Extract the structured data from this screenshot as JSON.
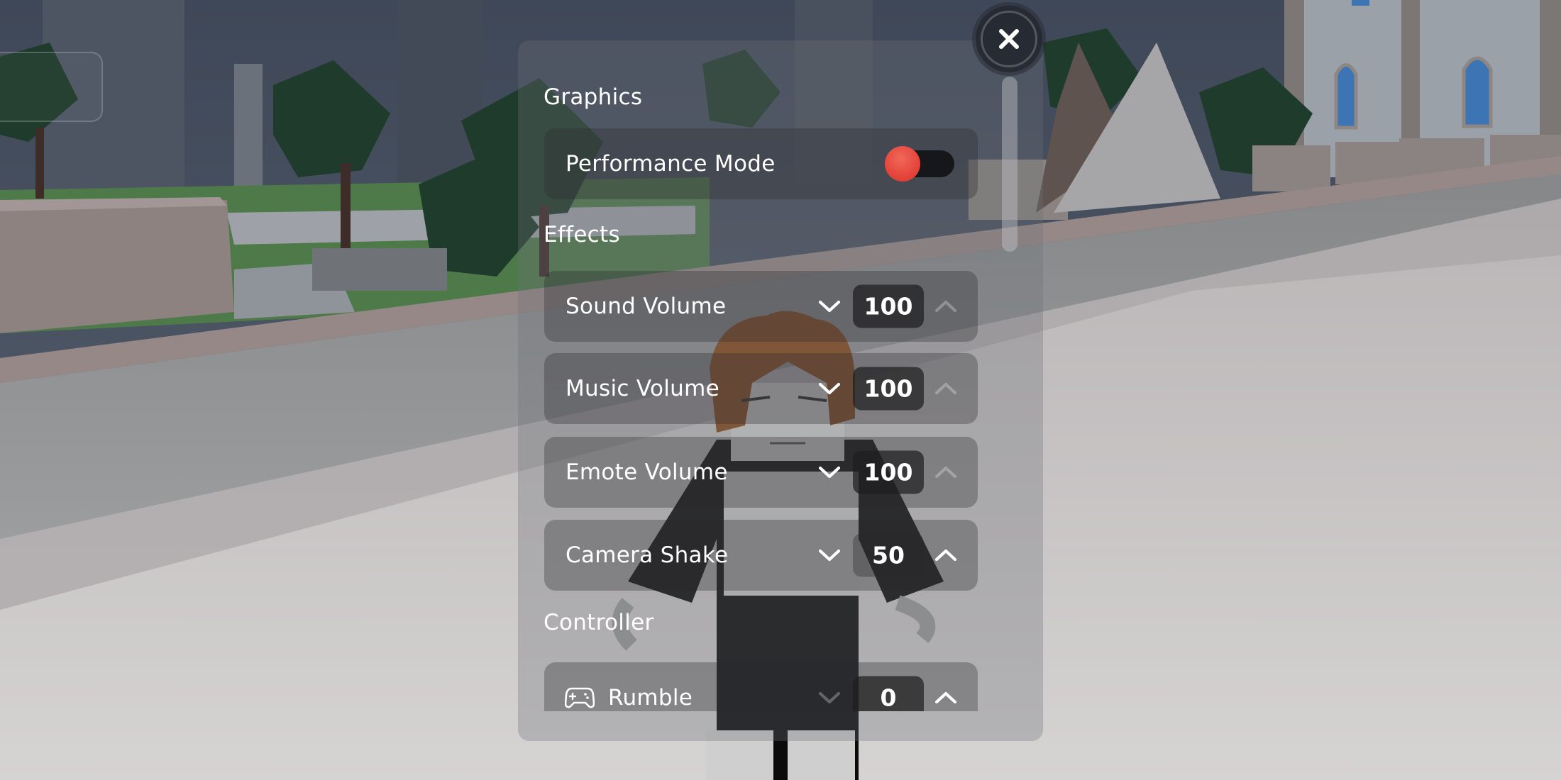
{
  "window": {
    "close_label": "Close settings"
  },
  "settings": {
    "sections": [
      {
        "title": "Graphics",
        "rows": [
          {
            "label": "Performance Mode",
            "type": "toggle",
            "value": "off"
          }
        ]
      },
      {
        "title": "Effects",
        "rows": [
          {
            "label": "Sound Volume",
            "type": "stepper",
            "value": "100",
            "down_enabled": true,
            "up_enabled": false
          },
          {
            "label": "Music Volume",
            "type": "stepper",
            "value": "100",
            "down_enabled": true,
            "up_enabled": false
          },
          {
            "label": "Emote Volume",
            "type": "stepper",
            "value": "100",
            "down_enabled": true,
            "up_enabled": false
          },
          {
            "label": "Camera Shake",
            "type": "stepper",
            "value": "50",
            "down_enabled": true,
            "up_enabled": true
          }
        ]
      },
      {
        "title": "Controller",
        "rows": [
          {
            "label": "Rumble",
            "type": "stepper",
            "icon": "gamepad-icon",
            "value": "0",
            "down_enabled": false,
            "up_enabled": true
          }
        ]
      }
    ]
  },
  "colors": {
    "toggle_knob": "#e5453a",
    "toggle_track": "#15171b",
    "text": "#ffffff"
  }
}
